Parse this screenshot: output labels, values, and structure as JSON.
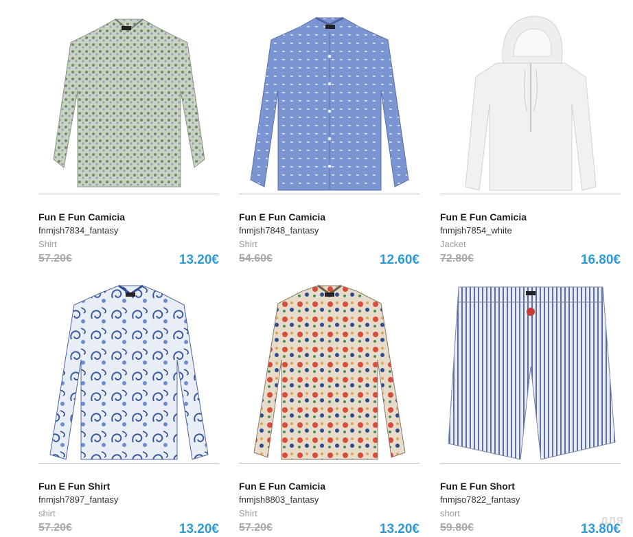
{
  "products": [
    {
      "title": "Fun E Fun Camicia",
      "sku": "fnmjsh7834_fantasy",
      "category": "Shirt",
      "old_price": "57.20€",
      "price": "13.20€",
      "image": "green-print-shirt-image"
    },
    {
      "title": "Fun E Fun Camicia",
      "sku": "fnmjsh7848_fantasy",
      "category": "Shirt",
      "old_price": "54.60€",
      "price": "12.60€",
      "image": "blue-dot-shirt-image"
    },
    {
      "title": "Fun E Fun Camicia",
      "sku": "fnmjsh7854_white",
      "category": "Jacket",
      "old_price": "72.80€",
      "price": "16.80€",
      "image": "white-hooded-jacket-image"
    },
    {
      "title": "Fun E Fun Shirt",
      "sku": "fnmjsh7897_fantasy",
      "category": "shirt",
      "old_price": "57.20€",
      "price": "13.20€",
      "image": "paisley-shirt-image"
    },
    {
      "title": "Fun E Fun Camicia",
      "sku": "fnmjsh8803_fantasy",
      "category": "Shirt",
      "old_price": "57.20€",
      "price": "13.20€",
      "image": "floral-shirt-image"
    },
    {
      "title": "Fun E Fun Short",
      "sku": "fnmjso7822_fantasy",
      "category": "short",
      "old_price": "59.80€",
      "price": "13.80€",
      "image": "striped-shorts-image"
    }
  ],
  "watermark": "для",
  "colors": {
    "price": "#2d9ad6",
    "old_price": "#a8a8a8",
    "divider": "#b9b9b9"
  }
}
